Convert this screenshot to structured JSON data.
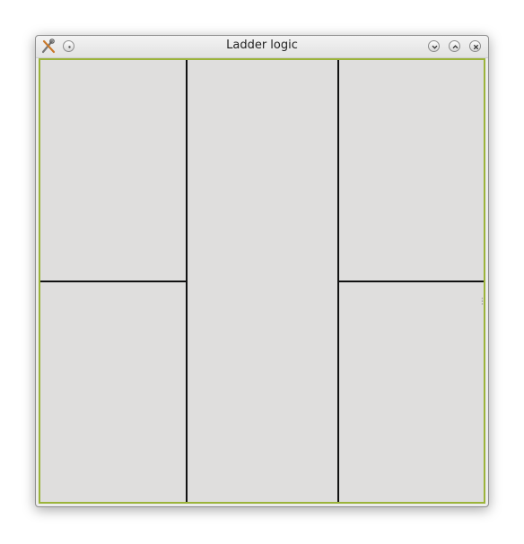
{
  "window": {
    "title": "Ladder logic",
    "app_icon": "tools-icon",
    "titlebar_buttons": {
      "left": [
        "menu-icon"
      ],
      "right": [
        "minimize-icon",
        "maximize-icon",
        "close-icon"
      ]
    },
    "accent_color": "#9bb33a"
  },
  "canvas": {
    "background": "#dfdedd",
    "line_color": "#111111"
  }
}
